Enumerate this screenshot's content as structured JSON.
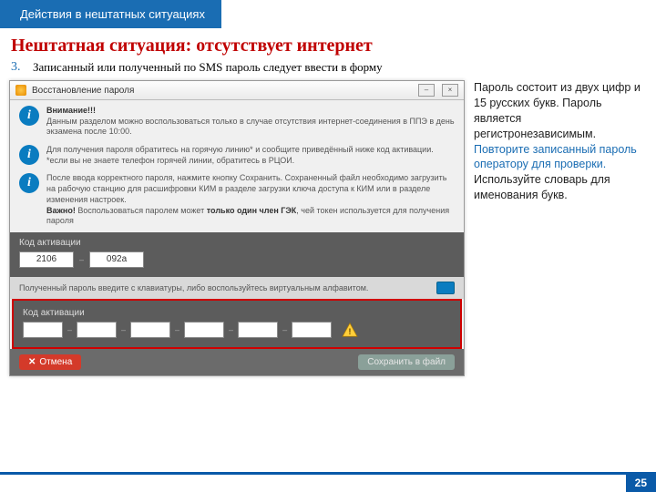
{
  "ribbon": "Действия в нештатных ситуациях",
  "situation_title": "Нештатная ситуация: отсутствует интернет",
  "step": {
    "num": "3.",
    "text": "Записанный или полученный по SMS пароль следует ввести в форму"
  },
  "dialog": {
    "title": "Восстановление пароля",
    "info1_head": "Внимание!!!",
    "info1_body": "Данным разделом можно воспользоваться только в случае отсутствия интернет-соединения в ППЭ в день экзамена после 10:00.",
    "info2_a": "Для получения пароля обратитесь на горячую линию* и сообщите приведённый ниже код активации.",
    "info2_b": "*если вы не знаете телефон горячей линии, обратитесь в РЦОИ.",
    "info3_a": "После ввода корректного пароля, нажмите кнопку Сохранить. Сохраненный файл необходимо загрузить на рабочую станцию для расшифровки КИМ в разделе загрузки ключа доступа к КИМ или в разделе изменения настроек.",
    "info3_head": "Важно!",
    "info3_b": " Воспользоваться паролем может ",
    "info3_strong": "только один член ГЭК",
    "info3_c": ", чей токен используется для получения пароля",
    "code_label": "Код активации",
    "code1": "2106",
    "code2": "092a",
    "mid_strip": "Полученный пароль введите с клавиатуры, либо воспользуйтесь виртуальным алфавитом.",
    "pwd_label": "Код активации",
    "btn_cancel": "Отмена",
    "btn_save": "Сохранить в файл"
  },
  "side": {
    "p1": "Пароль состоит из двух цифр и 15 русских букв. Пароль является регистронезависимым.",
    "p2": "Повторите записанный пароль оператору для проверки.",
    "p3": "Используйте словарь для именования букв."
  },
  "page": "25"
}
